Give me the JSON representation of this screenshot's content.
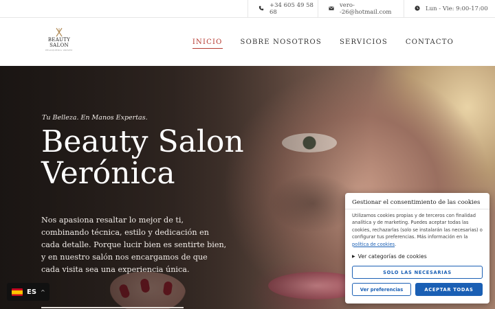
{
  "topbar": {
    "phone": "+34 605 49 58 68",
    "email": "vero--26@hotmail.com",
    "hours": "Lun - Vie: 9:00-17:00",
    "phone_icon": "phone-icon",
    "email_icon": "envelope-icon",
    "clock_icon": "clock-icon"
  },
  "logo": {
    "line1": "BEAUTY",
    "line2": "SALON",
    "line3": "PELUQUERIA UNISEX"
  },
  "nav": {
    "items": [
      {
        "label": "INICIO",
        "active": true
      },
      {
        "label": "SOBRE NOSOTROS",
        "active": false
      },
      {
        "label": "SERVICIOS",
        "active": false
      },
      {
        "label": "CONTACTO",
        "active": false
      }
    ],
    "active_color": "#b5382f"
  },
  "hero": {
    "tagline": "Tu Belleza. En Manos Expertas.",
    "title_line1": "Beauty Salon",
    "title_line2": "Verónica",
    "text": "Nos apasiona resaltar lo mejor de ti, combinando técnica, estilo y dedicación en cada detalle. Porque lucir bien es sentirte bien, y en nuestro salón nos encargamos de que cada visita sea una experiencia única."
  },
  "language": {
    "code": "ES",
    "flag": "spain-flag-icon"
  },
  "cookie": {
    "title": "Gestionar el consentimiento de las cookies",
    "body": "Utilizamos cookies propias y de terceros con finalidad analítica y de marketing. Puedes aceptar todas las cookies, rechazarlas (solo se instalarán las necesarias) o configurar tus preferencias. Más información en la ",
    "policy_link": "política de cookies",
    "body_end": ".",
    "categories_label": "Ver categorías de cookies",
    "only_necessary": "SOLO LAS NECESARIAS",
    "preferences": "Ver preferencias",
    "accept_all": "ACEPTAR TODAS",
    "accent": "#1a5fb4"
  }
}
